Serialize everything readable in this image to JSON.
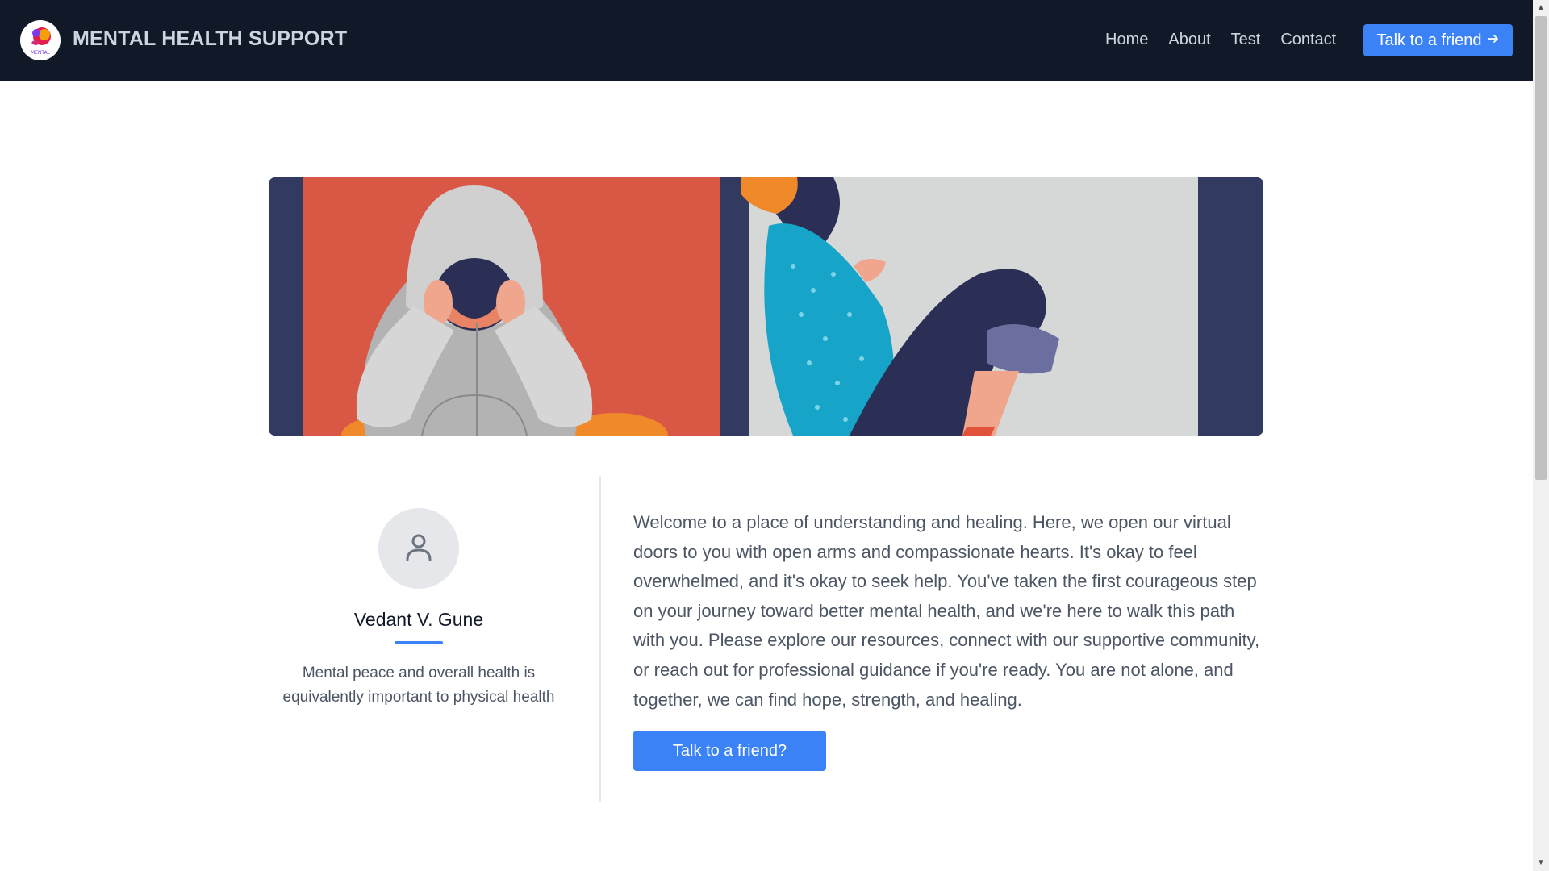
{
  "header": {
    "brand": "MENTAL HEALTH SUPPORT",
    "logo_text": "MENTAL",
    "nav": [
      "Home",
      "About",
      "Test",
      "Contact"
    ],
    "cta_label": "Talk to a friend",
    "cta_icon": "arrow-right-icon"
  },
  "hero": {
    "image_semantic": "hooded-person-and-sitting-woman-illustration"
  },
  "profile": {
    "name": "Vedant V. Gune",
    "tagline": "Mental peace and overall health is equivalently important to physical health",
    "avatar_icon": "user-icon"
  },
  "intro": {
    "paragraph": "Welcome to a place of understanding and healing. Here, we open our virtual doors to you with open arms and compassionate hearts. It's okay to feel overwhelmed, and it's okay to seek help. You've taken the first courageous step on your journey toward better mental health, and we're here to walk this path with you. Please explore our resources, connect with our supportive community, or reach out for professional guidance if you're ready. You are not alone, and together, we can find hope, strength, and healing.",
    "button_label": "Talk to a friend?"
  },
  "colors": {
    "header_bg": "#111827",
    "accent": "#3b82f6",
    "hero_left_bg": "#d95745",
    "hero_right_bg": "#d6d8d8",
    "hero_frame": "#333a62"
  }
}
